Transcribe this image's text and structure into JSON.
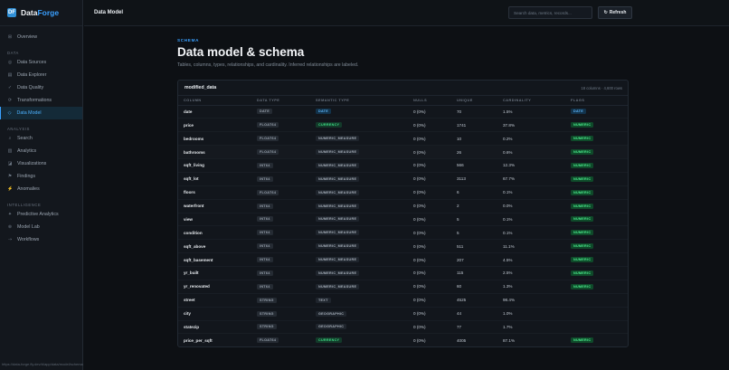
{
  "brand": {
    "name_a": "Data",
    "name_b": "Forge",
    "logo_glyph": "DF"
  },
  "sidebar": {
    "top": [
      {
        "label": "Overview",
        "icon": "grid-icon",
        "glyph": "⊞"
      }
    ],
    "sections": [
      {
        "title": "DATA",
        "items": [
          {
            "label": "Data Sources",
            "icon": "database-icon",
            "glyph": "◎",
            "active": false
          },
          {
            "label": "Data Explorer",
            "icon": "table-icon",
            "glyph": "▤",
            "active": false
          },
          {
            "label": "Data Quality",
            "icon": "check-icon",
            "glyph": "✓",
            "active": false
          },
          {
            "label": "Transformations",
            "icon": "transform-icon",
            "glyph": "⟳",
            "active": false
          },
          {
            "label": "Data Model",
            "icon": "model-icon",
            "glyph": "◇",
            "active": true
          }
        ]
      },
      {
        "title": "ANALYSIS",
        "items": [
          {
            "label": "Search",
            "icon": "search-icon",
            "glyph": "⌕",
            "active": false
          },
          {
            "label": "Analytics",
            "icon": "analytics-icon",
            "glyph": "▥",
            "active": false
          },
          {
            "label": "Visualizations",
            "icon": "chart-icon",
            "glyph": "◪",
            "active": false
          },
          {
            "label": "Findings",
            "icon": "flag-icon",
            "glyph": "⚑",
            "active": false
          },
          {
            "label": "Anomalies",
            "icon": "bolt-icon",
            "glyph": "⚡",
            "active": false
          }
        ]
      },
      {
        "title": "INTELLIGENCE",
        "items": [
          {
            "label": "Predictive Analytics",
            "icon": "sparkle-icon",
            "glyph": "✦",
            "active": false
          },
          {
            "label": "Model Lab",
            "icon": "lab-icon",
            "glyph": "⊛",
            "active": false
          },
          {
            "label": "Workflows",
            "icon": "workflow-icon",
            "glyph": "⇢",
            "active": false
          }
        ]
      }
    ]
  },
  "topbar": {
    "title": "Data Model",
    "search_placeholder": "Search data, metrics, records...",
    "refresh_label": "Refresh",
    "refresh_glyph": "↻"
  },
  "page": {
    "eyebrow": "SCHEMA",
    "title": "Data model & schema",
    "subtitle": "Tables, columns, types, relationships, and cardinality. Inferred relationships are labeled."
  },
  "table_card": {
    "name": "modified_data",
    "meta": "18 columns · 4,600 rows",
    "headers": [
      "COLUMN",
      "DATA TYPE",
      "SEMANTIC TYPE",
      "NULLS",
      "UNIQUE",
      "CARDINALITY",
      "FLAGS"
    ],
    "rows": [
      {
        "column": "date",
        "dtype": "DATE",
        "semantic": "DATE",
        "semantic_kind": "date",
        "nulls": "0 (0%)",
        "unique": "70",
        "cardinality": "1.5%",
        "flag": "DATE",
        "flag_kind": "date"
      },
      {
        "column": "price",
        "dtype": "FLOAT64",
        "semantic": "CURRENCY",
        "semantic_kind": "cur",
        "nulls": "0 (0%)",
        "unique": "1741",
        "cardinality": "37.8%",
        "flag": "NUMERIC",
        "flag_kind": "num"
      },
      {
        "column": "bedrooms",
        "dtype": "FLOAT64",
        "semantic": "NUMERIC_MEASURE",
        "semantic_kind": "num",
        "nulls": "0 (0%)",
        "unique": "10",
        "cardinality": "0.2%",
        "flag": "NUMERIC",
        "flag_kind": "num"
      },
      {
        "column": "bathrooms",
        "dtype": "FLOAT64",
        "semantic": "NUMERIC_MEASURE",
        "semantic_kind": "num",
        "nulls": "0 (0%)",
        "unique": "26",
        "cardinality": "0.6%",
        "flag": "NUMERIC",
        "flag_kind": "num",
        "highlight": true
      },
      {
        "column": "sqft_living",
        "dtype": "INT64",
        "semantic": "NUMERIC_MEASURE",
        "semantic_kind": "num",
        "nulls": "0 (0%)",
        "unique": "566",
        "cardinality": "12.3%",
        "flag": "NUMERIC",
        "flag_kind": "num"
      },
      {
        "column": "sqft_lot",
        "dtype": "INT64",
        "semantic": "NUMERIC_MEASURE",
        "semantic_kind": "num",
        "nulls": "0 (0%)",
        "unique": "3113",
        "cardinality": "67.7%",
        "flag": "NUMERIC",
        "flag_kind": "num"
      },
      {
        "column": "floors",
        "dtype": "FLOAT64",
        "semantic": "NUMERIC_MEASURE",
        "semantic_kind": "num",
        "nulls": "0 (0%)",
        "unique": "6",
        "cardinality": "0.1%",
        "flag": "NUMERIC",
        "flag_kind": "num"
      },
      {
        "column": "waterfront",
        "dtype": "INT64",
        "semantic": "NUMERIC_MEASURE",
        "semantic_kind": "num",
        "nulls": "0 (0%)",
        "unique": "2",
        "cardinality": "0.0%",
        "flag": "NUMERIC",
        "flag_kind": "num"
      },
      {
        "column": "view",
        "dtype": "INT64",
        "semantic": "NUMERIC_MEASURE",
        "semantic_kind": "num",
        "nulls": "0 (0%)",
        "unique": "5",
        "cardinality": "0.1%",
        "flag": "NUMERIC",
        "flag_kind": "num"
      },
      {
        "column": "condition",
        "dtype": "INT64",
        "semantic": "NUMERIC_MEASURE",
        "semantic_kind": "num",
        "nulls": "0 (0%)",
        "unique": "5",
        "cardinality": "0.1%",
        "flag": "NUMERIC",
        "flag_kind": "num"
      },
      {
        "column": "sqft_above",
        "dtype": "INT64",
        "semantic": "NUMERIC_MEASURE",
        "semantic_kind": "num",
        "nulls": "0 (0%)",
        "unique": "511",
        "cardinality": "11.1%",
        "flag": "NUMERIC",
        "flag_kind": "num"
      },
      {
        "column": "sqft_basement",
        "dtype": "INT64",
        "semantic": "NUMERIC_MEASURE",
        "semantic_kind": "num",
        "nulls": "0 (0%)",
        "unique": "207",
        "cardinality": "4.5%",
        "flag": "NUMERIC",
        "flag_kind": "num"
      },
      {
        "column": "yr_built",
        "dtype": "INT64",
        "semantic": "NUMERIC_MEASURE",
        "semantic_kind": "num",
        "nulls": "0 (0%)",
        "unique": "115",
        "cardinality": "2.5%",
        "flag": "NUMERIC",
        "flag_kind": "num"
      },
      {
        "column": "yr_renovated",
        "dtype": "INT64",
        "semantic": "NUMERIC_MEASURE",
        "semantic_kind": "num",
        "nulls": "0 (0%)",
        "unique": "60",
        "cardinality": "1.3%",
        "flag": "NUMERIC",
        "flag_kind": "num"
      },
      {
        "column": "street",
        "dtype": "STRING",
        "semantic": "TEXT",
        "semantic_kind": "text",
        "nulls": "0 (0%)",
        "unique": "4525",
        "cardinality": "98.4%",
        "flag": "",
        "flag_kind": ""
      },
      {
        "column": "city",
        "dtype": "STRING",
        "semantic": "GEOGRAPHIC",
        "semantic_kind": "text",
        "nulls": "0 (0%)",
        "unique": "44",
        "cardinality": "1.0%",
        "flag": "",
        "flag_kind": ""
      },
      {
        "column": "statezip",
        "dtype": "STRING",
        "semantic": "GEOGRAPHIC",
        "semantic_kind": "text",
        "nulls": "0 (0%)",
        "unique": "77",
        "cardinality": "1.7%",
        "flag": "",
        "flag_kind": ""
      },
      {
        "column": "price_per_sqft",
        "dtype": "FLOAT64",
        "semantic": "CURRENCY",
        "semantic_kind": "cur",
        "nulls": "0 (0%)",
        "unique": "4005",
        "cardinality": "87.1%",
        "flag": "NUMERIC",
        "flag_kind": "num"
      }
    ]
  },
  "statusbar": {
    "text": "https://data-forge.fly.dev/#/app/data/model/schema"
  }
}
